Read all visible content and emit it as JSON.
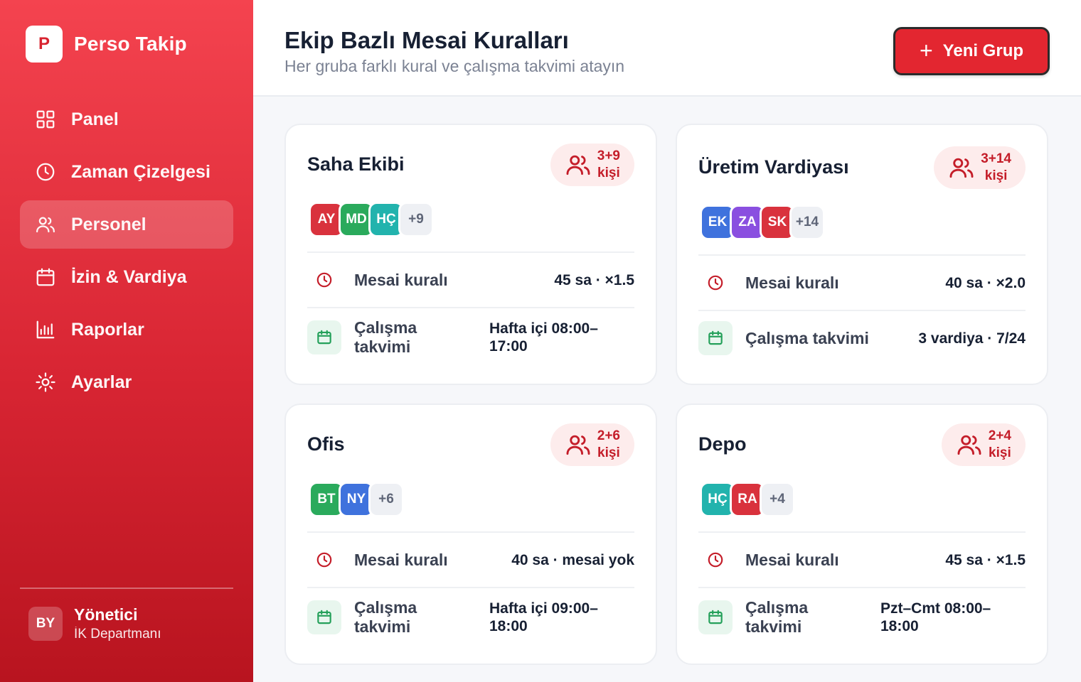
{
  "brand": {
    "logo_letter": "P",
    "name": "Perso Takip"
  },
  "nav": [
    {
      "label": "Panel",
      "icon": "grid-icon",
      "active": false
    },
    {
      "label": "Zaman Çizelgesi",
      "icon": "clock-icon",
      "active": false
    },
    {
      "label": "Personel",
      "icon": "users-icon",
      "active": true
    },
    {
      "label": "İzin & Vardiya",
      "icon": "calendar-icon",
      "active": false
    },
    {
      "label": "Raporlar",
      "icon": "bar-chart-icon",
      "active": false
    },
    {
      "label": "Ayarlar",
      "icon": "settings-icon",
      "active": false
    }
  ],
  "user": {
    "initials": "BY",
    "name": "Yönetici",
    "department": "İK Departmanı"
  },
  "header": {
    "title": "Ekip Bazlı Mesai Kuralları",
    "subtitle": "Her gruba farklı kural ve çalışma takvimi atayın",
    "new_button_icon": "+",
    "new_button_label": "Yeni Grup"
  },
  "labels": {
    "overtime_rule": "Mesai kuralı",
    "work_schedule": "Çalışma takvimi"
  },
  "groups": [
    {
      "name": "Saha Ekibi",
      "count_line1": "3+9",
      "count_line2": "kişi",
      "avatars": [
        {
          "initials": "AY",
          "color": "#d9323d"
        },
        {
          "initials": "MD",
          "color": "#2aaa5c"
        },
        {
          "initials": "HÇ",
          "color": "#22b3ad"
        }
      ],
      "more": "+9",
      "overtime": "45 sa · ×1.5",
      "schedule": "Hafta içi 08:00–17:00"
    },
    {
      "name": "Üretim Vardiyası",
      "count_line1": "3+14",
      "count_line2": "kişi",
      "avatars": [
        {
          "initials": "EK",
          "color": "#3f72dd"
        },
        {
          "initials": "ZA",
          "color": "#8a4fe0"
        },
        {
          "initials": "SK",
          "color": "#d9323d"
        }
      ],
      "more": "+14",
      "overtime": "40 sa · ×2.0",
      "schedule": "3 vardiya · 7/24"
    },
    {
      "name": "Ofis",
      "count_line1": "2+6",
      "count_line2": "kişi",
      "avatars": [
        {
          "initials": "BT",
          "color": "#2aaa5c"
        },
        {
          "initials": "NY",
          "color": "#3f72dd"
        }
      ],
      "more": "+6",
      "overtime": "40 sa · mesai yok",
      "schedule": "Hafta içi 09:00–18:00"
    },
    {
      "name": "Depo",
      "count_line1": "2+4",
      "count_line2": "kişi",
      "avatars": [
        {
          "initials": "HÇ",
          "color": "#22b3ad"
        },
        {
          "initials": "RA",
          "color": "#d9323d"
        }
      ],
      "more": "+4",
      "overtime": "45 sa · ×1.5",
      "schedule": "Pzt–Cmt 08:00–18:00"
    }
  ]
}
